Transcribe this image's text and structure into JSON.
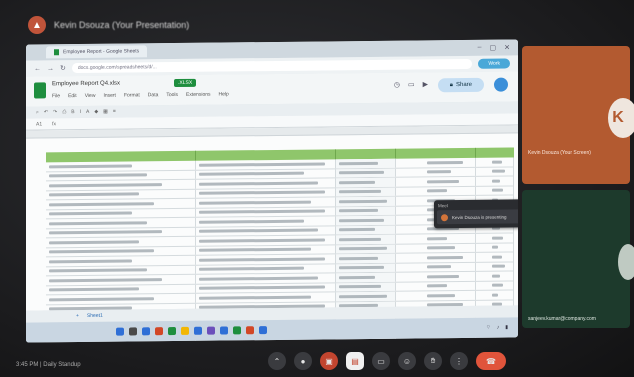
{
  "meet": {
    "banner": "Kevin Dsouza (Your Presentation)",
    "time": "3:45 PM | Daily Standup",
    "controls": [
      "arrow-up-icon",
      "mic-icon",
      "camera-off-icon",
      "captions-icon",
      "present-icon",
      "emoji-icon",
      "raise-hand-icon",
      "more-icon",
      "end-call-icon"
    ]
  },
  "browser": {
    "tab_label": "Employee Report - Google Sheets",
    "url": "docs.google.com/spreadsheets/d/...",
    "profile_pill": "Work",
    "win_controls": [
      "–",
      "▢",
      "✕"
    ]
  },
  "sheet": {
    "title": "Employee Report Q4.xlsx",
    "badge": ".XLSX",
    "menu": [
      "File",
      "Edit",
      "View",
      "Insert",
      "Format",
      "Data",
      "Tools",
      "Extensions",
      "Help"
    ],
    "share_label": "Share",
    "formula_ref": "A1",
    "tabs": [
      "Sheet1"
    ],
    "rows": 24
  },
  "popup": {
    "header": "Meet",
    "item": "Kevin Dsouza is presenting"
  },
  "participants": [
    {
      "name": "Kevin Dsouza (Your Screen)",
      "initial": "K",
      "color": "#b35a30"
    },
    {
      "name": "sanjeev.kumar@company.com",
      "initial": "",
      "color": "#1d3a2c"
    }
  ]
}
